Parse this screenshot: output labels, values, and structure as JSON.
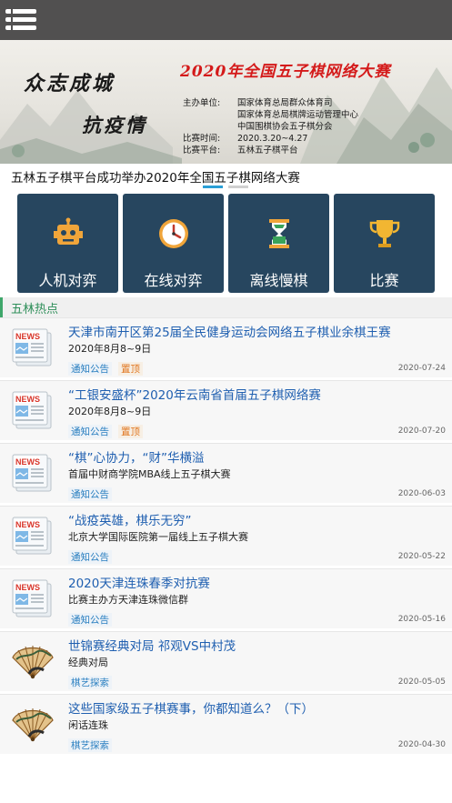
{
  "topbar": {
    "menu_icon": "hamburger-menu-icon"
  },
  "banner": {
    "title": "2020年全国五子棋网络大赛",
    "slogan_line1": "众志成城",
    "slogan_line2": "抗疫情",
    "info": [
      {
        "label": "主办单位:",
        "value": "国家体育总局群众体育司"
      },
      {
        "label": "",
        "value": "国家体育总局棋牌运动管理中心"
      },
      {
        "label": "",
        "value": "中国围棋协会五子棋分会"
      },
      {
        "label": "比赛时间:",
        "value": "2020.3.20~4.27"
      },
      {
        "label": "比赛平台:",
        "value": "五林五子棋平台"
      }
    ]
  },
  "headline": "五林五子棋平台成功举办2020年全国五子棋网络大赛",
  "carousel": {
    "count": 2,
    "active": 0,
    "active_color": "#2a9fd6"
  },
  "tiles": [
    {
      "label": "人机对弈",
      "icon": "robot-icon"
    },
    {
      "label": "在线对弈",
      "icon": "clock-icon"
    },
    {
      "label": "离线慢棋",
      "icon": "hourglass-icon"
    },
    {
      "label": "比赛",
      "icon": "trophy-icon"
    }
  ],
  "section_title": "五林热点",
  "news": [
    {
      "title": "天津市南开区第25届全民健身运动会网络五子棋业余棋王赛",
      "subtitle": "2020年8月8~9日",
      "tags": [
        "通知公告",
        "置顶"
      ],
      "date": "2020-07-24",
      "thumb": "news-icon"
    },
    {
      "title": "“工银安盛杯”2020年云南省首届五子棋网络赛",
      "subtitle": "2020年8月8~9日",
      "tags": [
        "通知公告",
        "置顶"
      ],
      "date": "2020-07-20",
      "thumb": "news-icon"
    },
    {
      "title": "“棋”心协力，“财”华横溢",
      "subtitle": "首届中财商学院MBA线上五子棋大赛",
      "tags": [
        "通知公告"
      ],
      "date": "2020-06-03",
      "thumb": "news-icon"
    },
    {
      "title": "“战疫英雄，棋乐无穷”",
      "subtitle": "北京大学国际医院第一届线上五子棋大赛",
      "tags": [
        "通知公告"
      ],
      "date": "2020-05-22",
      "thumb": "news-icon"
    },
    {
      "title": "2020天津连珠春季对抗赛",
      "subtitle": "比赛主办方天津连珠微信群",
      "tags": [
        "通知公告"
      ],
      "date": "2020-05-16",
      "thumb": "news-icon"
    },
    {
      "title": "世锦赛经典对局 祁观VS中村茂",
      "subtitle": "经典对局",
      "tags": [
        "棋艺探索"
      ],
      "date": "2020-05-05",
      "thumb": "folding-fan-icon"
    },
    {
      "title": "这些国家级五子棋赛事，你都知道么？（下）",
      "subtitle": "闲话连珠",
      "tags": [
        "棋艺探索"
      ],
      "date": "2020-04-30",
      "thumb": "folding-fan-icon"
    }
  ]
}
